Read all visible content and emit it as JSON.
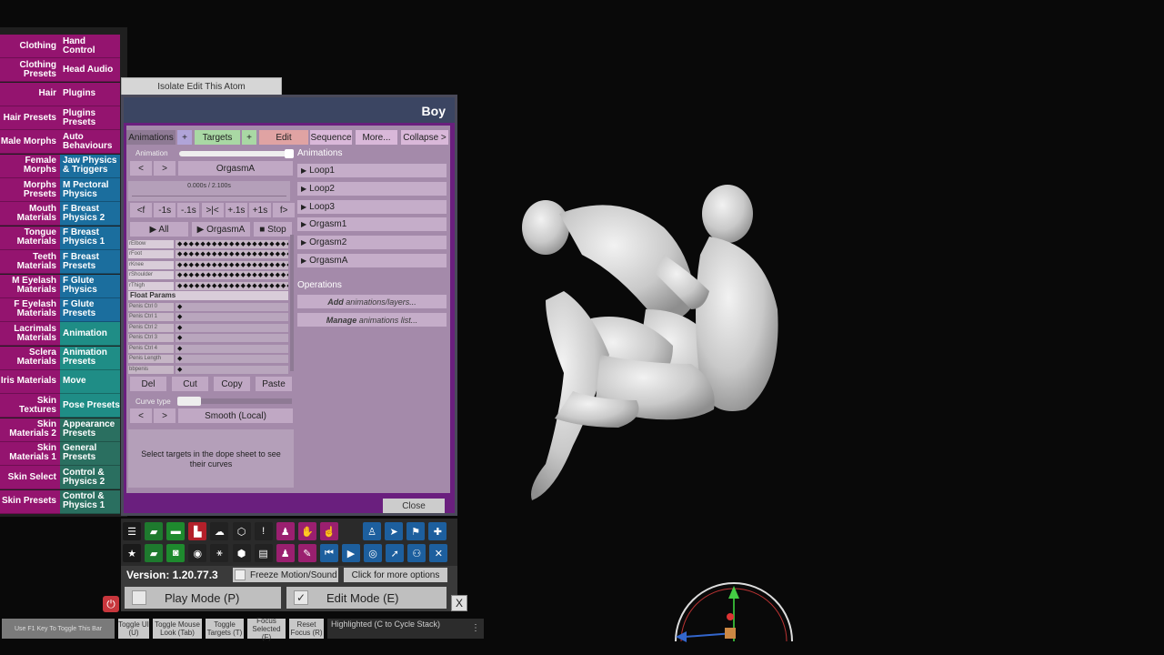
{
  "categories": [
    {
      "left": "Clothing",
      "right": "Hand Control",
      "right_color": "#94146f"
    },
    {
      "left": "Clothing Presets",
      "right": "Head Audio",
      "right_color": "#94146f"
    },
    {
      "left": "Hair",
      "right": "Plugins",
      "right_color": "#94146f"
    },
    {
      "left": "Hair Presets",
      "right": "Plugins Presets",
      "right_color": "#94146f"
    },
    {
      "left": "Male Morphs",
      "right": "Auto Behaviours",
      "right_color": "#94146f"
    },
    {
      "left": "Female Morphs",
      "right": "Jaw Physics & Triggers",
      "right_color": "#1b6e9e"
    },
    {
      "left": "Morphs Presets",
      "right": "M Pectoral Physics",
      "right_color": "#1b6e9e"
    },
    {
      "left": "Mouth Materials",
      "right": "F Breast Physics 2",
      "right_color": "#1b6e9e"
    },
    {
      "left": "Tongue Materials",
      "right": "F Breast Physics 1",
      "right_color": "#1b6e9e"
    },
    {
      "left": "Teeth Materials",
      "right": "F Breast Presets",
      "right_color": "#1b6e9e"
    },
    {
      "left": "M Eyelash Materials",
      "right": "F Glute Physics",
      "right_color": "#1b6e9e"
    },
    {
      "left": "F Eyelash Materials",
      "right": "F Glute Presets",
      "right_color": "#1b6e9e"
    },
    {
      "left": "Lacrimals Materials",
      "right": "Animation",
      "right_color": "#1f8d86"
    },
    {
      "left": "Sclera Materials",
      "right": "Animation Presets",
      "right_color": "#1f8d86"
    },
    {
      "left": "Iris Materials",
      "right": "Move",
      "right_color": "#1f8d86"
    },
    {
      "left": "Skin Textures",
      "right": "Pose Presets",
      "right_color": "#1f8d86"
    },
    {
      "left": "Skin Materials 2",
      "right": "Appearance Presets",
      "right_color": "#2a6f60"
    },
    {
      "left": "Skin Materials 1",
      "right": "General Presets",
      "right_color": "#2a6f60"
    },
    {
      "left": "Skin Select",
      "right": "Control & Physics 2",
      "right_color": "#2a6f60"
    },
    {
      "left": "Skin Presets",
      "right": "Control & Physics 1",
      "right_color": "#2a6f60"
    }
  ],
  "isolate_label": "Isolate Edit This Atom",
  "window": {
    "title": "Boy",
    "tabs": {
      "animations": "Animations",
      "plus1": "+",
      "targets": "Targets",
      "plus2": "+",
      "edit": "Edit",
      "sequence": "Sequence",
      "more": "More...",
      "collapse": "Collapse >"
    },
    "animation_label": "Animation",
    "prev": "<",
    "next": ">",
    "current_animation": "OrgasmA",
    "time_display": "0.000s / 2.100s",
    "transport": [
      "<f",
      "-1s",
      "-.1s",
      ">|<",
      "+.1s",
      "+1s",
      "f>"
    ],
    "play_all": "▶ All",
    "play_current": "▶ OrgasmA",
    "stop": "■ Stop",
    "targets": [
      "rElbow",
      "rFoot",
      "rKnee",
      "rShoulder",
      "rThigh"
    ],
    "float_params_label": "Float Params",
    "float_params": [
      "Penis Ctrl 0",
      "Penis Ctrl 1",
      "Penis Ctrl 2",
      "Penis Ctrl 3",
      "Penis Ctrl 4",
      "Penis Length",
      "bbpenis"
    ],
    "clip": {
      "del": "Del",
      "cut": "Cut",
      "copy": "Copy",
      "paste": "Paste"
    },
    "curve_type_label": "Curve type",
    "curve_type_value": "Smooth (Local)",
    "curve_help": "Select targets in the dope sheet to see their curves",
    "animations_header": "Animations",
    "animations": [
      "Loop1",
      "Loop2",
      "Loop3",
      "Orgasm1",
      "Orgasm2",
      "OrgasmA"
    ],
    "operations_header": "Operations",
    "op_add_bold": "Add",
    "op_add_rest": "animations/layers...",
    "op_manage_bold": "Manage",
    "op_manage_rest": "animations list...",
    "close": "Close"
  },
  "toolbar_icons_row1": [
    {
      "name": "menu-icon",
      "color": "#1a1a1a",
      "glyph": "☰"
    },
    {
      "name": "save-scene-icon",
      "color": "#1e7a2e",
      "glyph": "▰"
    },
    {
      "name": "open-folder-icon",
      "color": "#1e8a2e",
      "glyph": "▬"
    },
    {
      "name": "delete-scene-icon",
      "color": "#b3202a",
      "glyph": "▙"
    },
    {
      "name": "cloud-icon",
      "color": "#222",
      "glyph": "☁"
    },
    {
      "name": "package-icon",
      "color": "#222",
      "glyph": "⬡"
    },
    {
      "name": "alert-icon",
      "color": "#222",
      "glyph": "!"
    },
    {
      "name": "person-edit-icon",
      "color": "#9a1f6f",
      "glyph": "♟"
    },
    {
      "name": "hand-icon",
      "color": "#9a1f6f",
      "glyph": "✋"
    },
    {
      "name": "touch-icon",
      "color": "#9a1f6f",
      "glyph": "☝"
    },
    {
      "name": "person-icon",
      "color": "#1d5f9e",
      "glyph": "♙"
    },
    {
      "name": "send-icon",
      "color": "#1d5f9e",
      "glyph": "➤"
    },
    {
      "name": "flag-icon",
      "color": "#1d5f9e",
      "glyph": "⚑"
    },
    {
      "name": "add-icon",
      "color": "#1d5f9e",
      "glyph": "✚"
    }
  ],
  "toolbar_icons_row2": [
    {
      "name": "star-icon",
      "color": "#1a1a1a",
      "glyph": "★"
    },
    {
      "name": "open-scene-icon",
      "color": "#1e7a2e",
      "glyph": "▰"
    },
    {
      "name": "camera-folder-icon",
      "color": "#1e8a2e",
      "glyph": "◙"
    },
    {
      "name": "screenshot-icon",
      "color": "#222",
      "glyph": "◉"
    },
    {
      "name": "network-icon",
      "color": "#222",
      "glyph": "⚹"
    },
    {
      "name": "settings-package-icon",
      "color": "#222",
      "glyph": "⬢"
    },
    {
      "name": "document-icon",
      "color": "#222",
      "glyph": "▤"
    },
    {
      "name": "person-remove-icon",
      "color": "#9a1f6f",
      "glyph": "♟"
    },
    {
      "name": "brush-icon",
      "color": "#9a1f6f",
      "glyph": "✎"
    },
    {
      "name": "skip-back-icon",
      "color": "#1d5f9e",
      "glyph": "⏮"
    },
    {
      "name": "play-icon",
      "color": "#1d5f9e",
      "glyph": "▶"
    },
    {
      "name": "target-icon",
      "color": "#1d5f9e",
      "glyph": "◎"
    },
    {
      "name": "cursor-icon",
      "color": "#1d5f9e",
      "glyph": "➚"
    },
    {
      "name": "people-icon",
      "color": "#1d5f9e",
      "glyph": "⚇"
    },
    {
      "name": "tools-icon",
      "color": "#1d5f9e",
      "glyph": "✕"
    }
  ],
  "version": "Version: 1.20.77.3",
  "freeze_motion": "Freeze Motion/Sound",
  "more_options": "Click for more options",
  "play_mode": "Play Mode (P)",
  "edit_mode": "Edit Mode (E)",
  "edit_mode_check": "✓",
  "close_x": "X",
  "f1_hint": "Use F1 Key To Toggle This Bar",
  "bottom_buttons": [
    "Toggle UI (U)",
    "Toggle Mouse Look (Tab)",
    "Toggle Targets (T)",
    "Focus Selected (F)",
    "Reset Focus (R)"
  ],
  "highlighted": "Highlighted (C to Cycle Stack)"
}
